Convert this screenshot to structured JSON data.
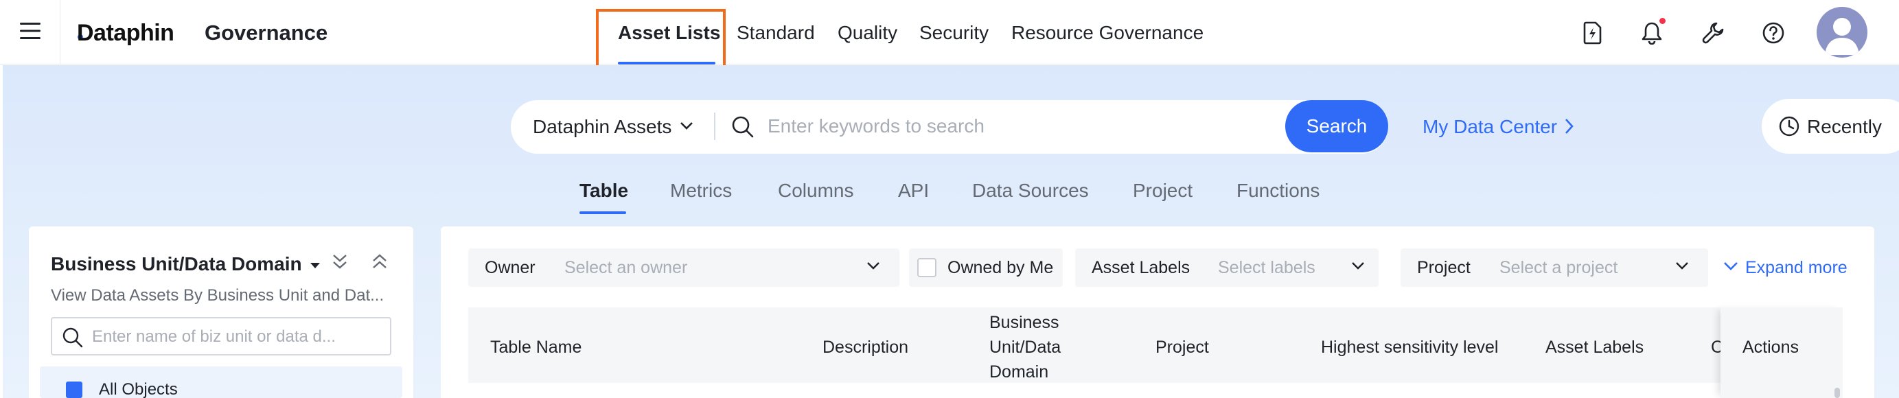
{
  "topbar": {
    "brand": "Dataphin",
    "product": "Governance",
    "nav": [
      {
        "label": "Asset Lists",
        "active": true
      },
      {
        "label": "Standard",
        "active": false
      },
      {
        "label": "Quality",
        "active": false
      },
      {
        "label": "Security",
        "active": false
      },
      {
        "label": "Resource Governance",
        "active": false
      }
    ],
    "icons": [
      "lightning-file-icon",
      "bell-icon",
      "wrench-icon",
      "help-icon"
    ],
    "has_notification": true
  },
  "search": {
    "scope": "Dataphin Assets",
    "placeholder": "Enter keywords to search",
    "button": "Search",
    "data_center": "My Data Center",
    "recently": "Recently"
  },
  "tabs": [
    {
      "label": "Table",
      "active": true
    },
    {
      "label": "Metrics",
      "active": false
    },
    {
      "label": "Columns",
      "active": false
    },
    {
      "label": "API",
      "active": false
    },
    {
      "label": "Data Sources",
      "active": false
    },
    {
      "label": "Project",
      "active": false
    },
    {
      "label": "Functions",
      "active": false
    }
  ],
  "left_panel": {
    "title": "Business Unit/Data Domain",
    "subtitle": "View Data Assets By Business Unit and Dat...",
    "search_placeholder": "Enter name of biz unit or data d...",
    "all_objects": "All Objects"
  },
  "filters": {
    "owner_label": "Owner",
    "owner_placeholder": "Select an owner",
    "owned_by_me": "Owned by Me",
    "asset_labels_label": "Asset Labels",
    "asset_labels_placeholder": "Select labels",
    "project_label": "Project",
    "project_placeholder": "Select a project",
    "expand_more": "Expand more"
  },
  "table": {
    "columns": [
      "Table Name",
      "Description",
      "Business Unit/Data Domain",
      "Project",
      "Highest sensitivity level",
      "Asset Labels",
      "C",
      "Actions"
    ]
  },
  "colors": {
    "accent": "#2f6bf6",
    "highlight": "#f26b1d",
    "notification": "#f2334a"
  }
}
